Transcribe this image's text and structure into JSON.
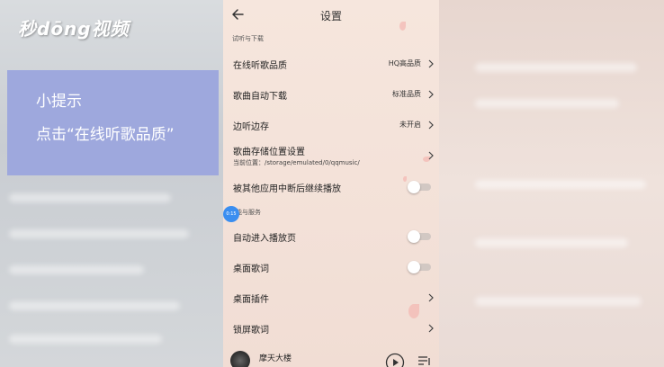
{
  "watermark": {
    "text": "秒dōng视频"
  },
  "tip": {
    "title": "小提示",
    "text": "点击“在线听歌品质”"
  },
  "header": {
    "title": "设置"
  },
  "sections": {
    "listen_download": "试听与下载",
    "features_services": "能与服务"
  },
  "rows": {
    "online_quality": {
      "label": "在线听歌品质",
      "value": "HQ高品质"
    },
    "auto_download": {
      "label": "歌曲自动下载",
      "value": "标准品质"
    },
    "cache_while_listening": {
      "label": "边听边存",
      "value": "未开启"
    },
    "storage_location": {
      "label": "歌曲存储位置设置",
      "sub": "当前位置：/storage/emulated/0/qqmusic/"
    },
    "resume_after_interrupt": {
      "label": "被其他应用中断后继续播放",
      "toggle": false
    },
    "auto_enter_player": {
      "label": "自动进入播放页",
      "toggle": false
    },
    "desktop_lyrics": {
      "label": "桌面歌词",
      "toggle": false
    },
    "desktop_widget": {
      "label": "桌面插件"
    },
    "lockscreen_lyrics": {
      "label": "锁屏歌词"
    }
  },
  "badge": {
    "text": "0:15"
  },
  "player": {
    "song_title": "摩天大楼"
  },
  "colors": {
    "tip_background": "#9ea8dd",
    "screen_background": "#f6e6dd",
    "badge": "#3a8ef0"
  },
  "icons": [
    "back-arrow-icon",
    "chevron-right-icon",
    "play-icon",
    "playlist-icon"
  ]
}
